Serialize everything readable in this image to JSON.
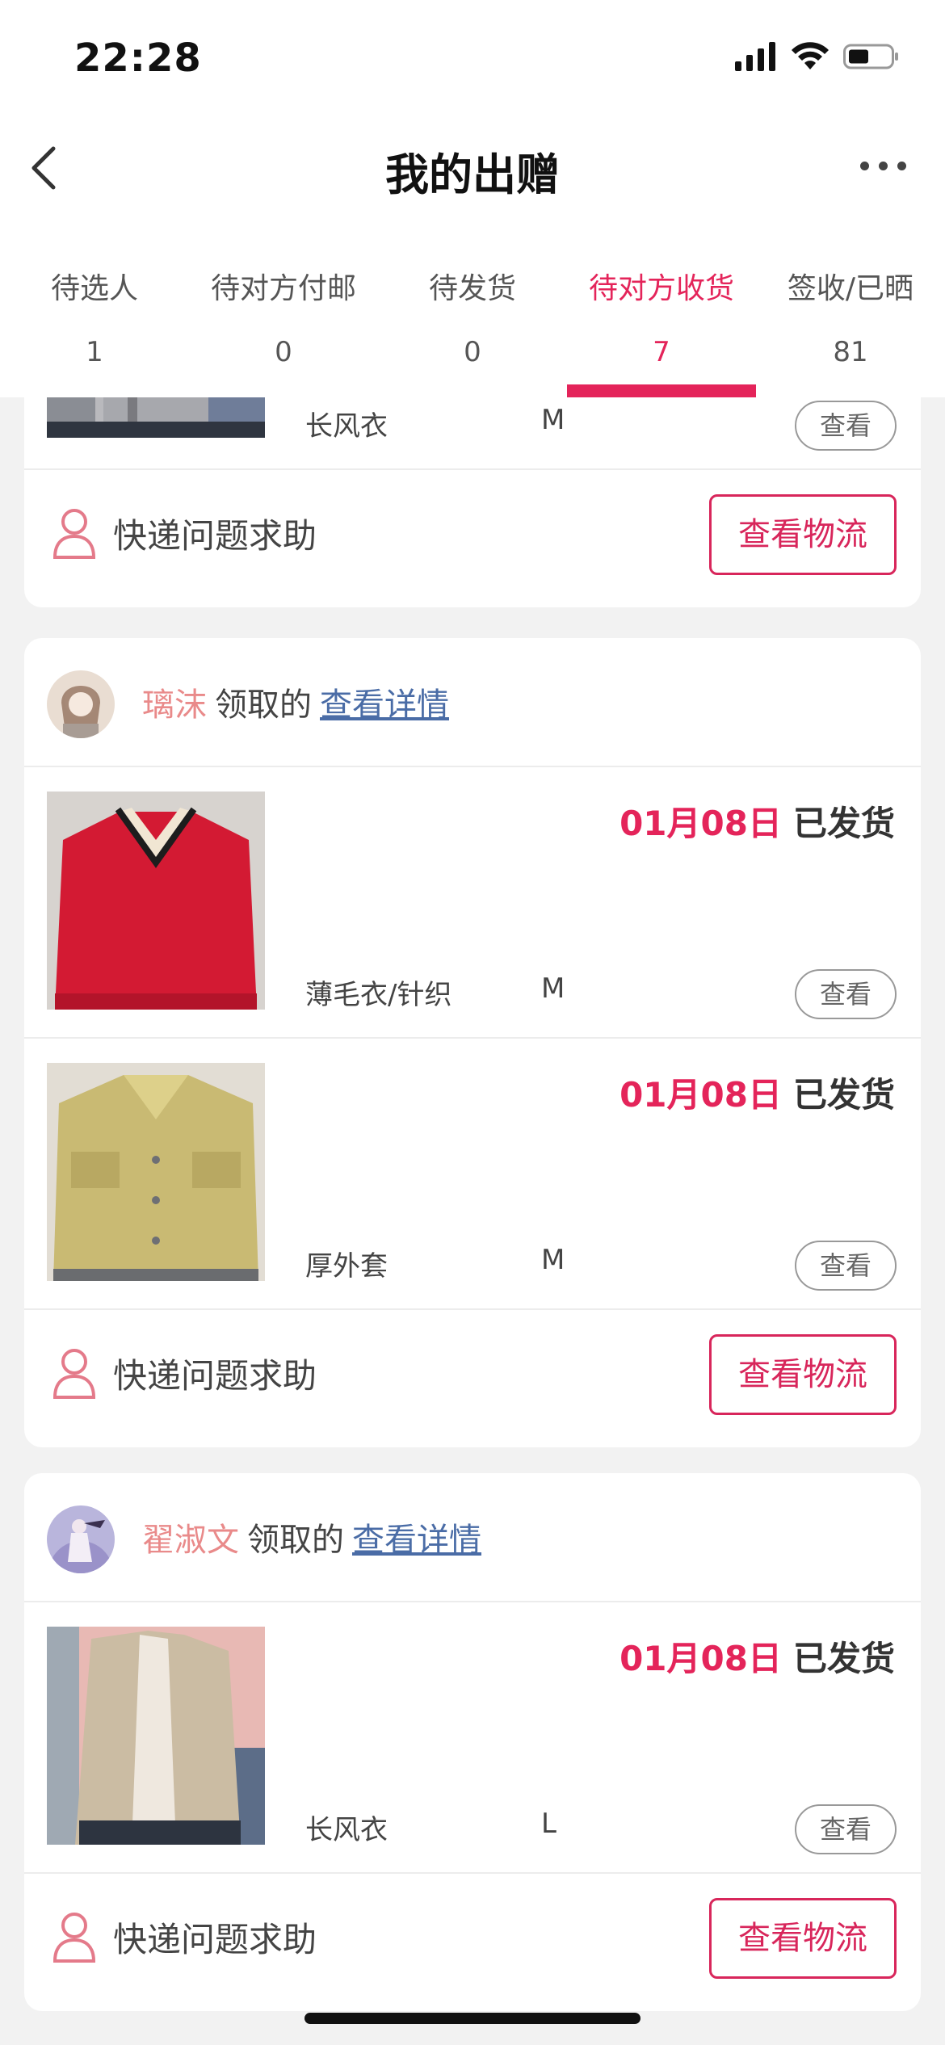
{
  "status_bar": {
    "time": "22:28"
  },
  "nav": {
    "title": "我的出赠"
  },
  "tabs": [
    {
      "label": "待选人",
      "count": "1"
    },
    {
      "label": "待对方付邮",
      "count": "0"
    },
    {
      "label": "待发货",
      "count": "0"
    },
    {
      "label": "待对方收货",
      "count": "7",
      "active": true
    },
    {
      "label": "签收/已晒",
      "count": "81"
    }
  ],
  "cards": [
    {
      "items": [
        {
          "category": "长风衣",
          "size": "M",
          "view_label": "查看"
        }
      ],
      "help_label": "快递问题求助",
      "logistics_label": "查看物流"
    },
    {
      "nickname": "璃沫",
      "receive_text": "领取的",
      "detail_label": "查看详情",
      "items": [
        {
          "date": "01月08日",
          "status": "已发货",
          "category": "薄毛衣/针织",
          "size": "M",
          "view_label": "查看"
        },
        {
          "date": "01月08日",
          "status": "已发货",
          "category": "厚外套",
          "size": "M",
          "view_label": "查看"
        }
      ],
      "help_label": "快递问题求助",
      "logistics_label": "查看物流"
    },
    {
      "nickname": "翟淑文",
      "receive_text": "领取的",
      "detail_label": "查看详情",
      "items": [
        {
          "date": "01月08日",
          "status": "已发货",
          "category": "长风衣",
          "size": "L",
          "view_label": "查看"
        }
      ],
      "help_label": "快递问题求助",
      "logistics_label": "查看物流"
    }
  ],
  "colors": {
    "accent": "#e4245a",
    "nickname": "#e98a8a",
    "link": "#4a6ca6"
  }
}
